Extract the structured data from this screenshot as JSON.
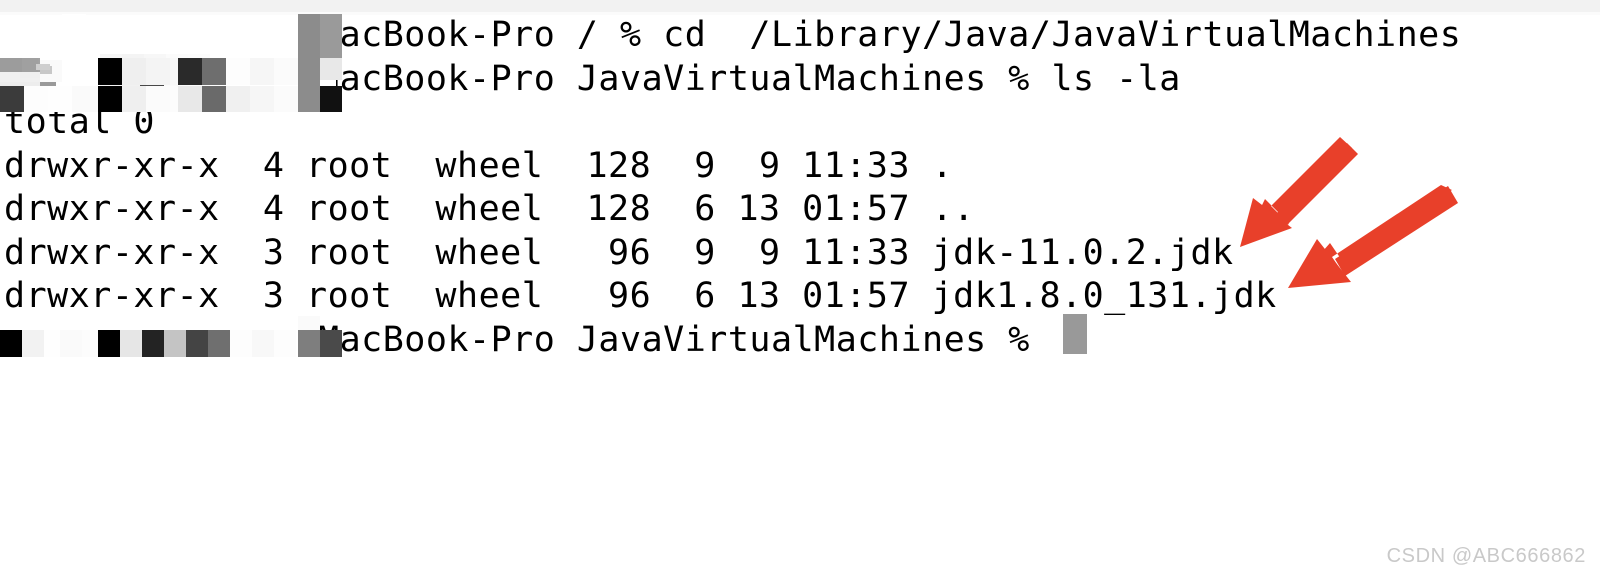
{
  "window": {
    "title_bar_color": "#f2f2f2",
    "background": "#ffffff",
    "text_color": "#000000"
  },
  "terminal": {
    "font_color": "#000000",
    "cursor_color": "#999999",
    "lines": [
      {
        "id": "line-cd-command",
        "redacted_prefix": true,
        "text": "MacBook-Pro / % cd  /Library/Java/JavaVirtualMachines"
      },
      {
        "id": "line-ls-command",
        "redacted_prefix": true,
        "text": "MacBook-Pro JavaVirtualMachines % ls -la"
      },
      {
        "id": "line-total",
        "redacted_prefix": false,
        "text": "total 0"
      },
      {
        "id": "line-entry-dot",
        "redacted_prefix": false,
        "text": "drwxr-xr-x  4 root  wheel  128  9  9 11:33 ."
      },
      {
        "id": "line-entry-dotdot",
        "redacted_prefix": false,
        "text": "drwxr-xr-x  4 root  wheel  128  6 13 01:57 .."
      },
      {
        "id": "line-entry-jdk11",
        "redacted_prefix": false,
        "text": "drwxr-xr-x  3 root  wheel   96  9  9 11:33 jdk-11.0.2.jdk"
      },
      {
        "id": "line-entry-jdk18",
        "redacted_prefix": false,
        "text": "drwxr-xr-x  3 root  wheel   96  6 13 01:57 jdk1.8.0_131.jdk"
      },
      {
        "id": "line-prompt-final",
        "redacted_prefix": true,
        "text": "MacBook-Pro JavaVirtualMachines % "
      }
    ],
    "listing": {
      "columns": [
        "permissions",
        "links",
        "owner",
        "group",
        "size",
        "month",
        "day",
        "time",
        "name"
      ],
      "total_label": "total 0",
      "rows": [
        {
          "permissions": "drwxr-xr-x",
          "links": "4",
          "owner": "root",
          "group": "wheel",
          "size": "128",
          "month": "9",
          "day": "9",
          "time": "11:33",
          "name": "."
        },
        {
          "permissions": "drwxr-xr-x",
          "links": "4",
          "owner": "root",
          "group": "wheel",
          "size": "128",
          "month": "6",
          "day": "13",
          "time": "01:57",
          "name": ".."
        },
        {
          "permissions": "drwxr-xr-x",
          "links": "3",
          "owner": "root",
          "group": "wheel",
          "size": "96",
          "month": "9",
          "day": "9",
          "time": "11:33",
          "name": "jdk-11.0.2.jdk"
        },
        {
          "permissions": "drwxr-xr-x",
          "links": "3",
          "owner": "root",
          "group": "wheel",
          "size": "96",
          "month": "6",
          "day": "13",
          "time": "01:57",
          "name": "jdk1.8.0_131.jdk"
        }
      ]
    },
    "commands": [
      "cd  /Library/Java/JavaVirtualMachines",
      "ls -la"
    ]
  },
  "annotations": {
    "arrow_color": "#e8402a",
    "arrows": [
      {
        "name": "arrow-jdk-11",
        "points_to": "jdk-11.0.2.jdk"
      },
      {
        "name": "arrow-jdk-18",
        "points_to": "jdk1.8.0_131.jdk"
      }
    ]
  },
  "watermark": {
    "text": "CSDN @ABC666862",
    "color": "#c9c9c9"
  }
}
